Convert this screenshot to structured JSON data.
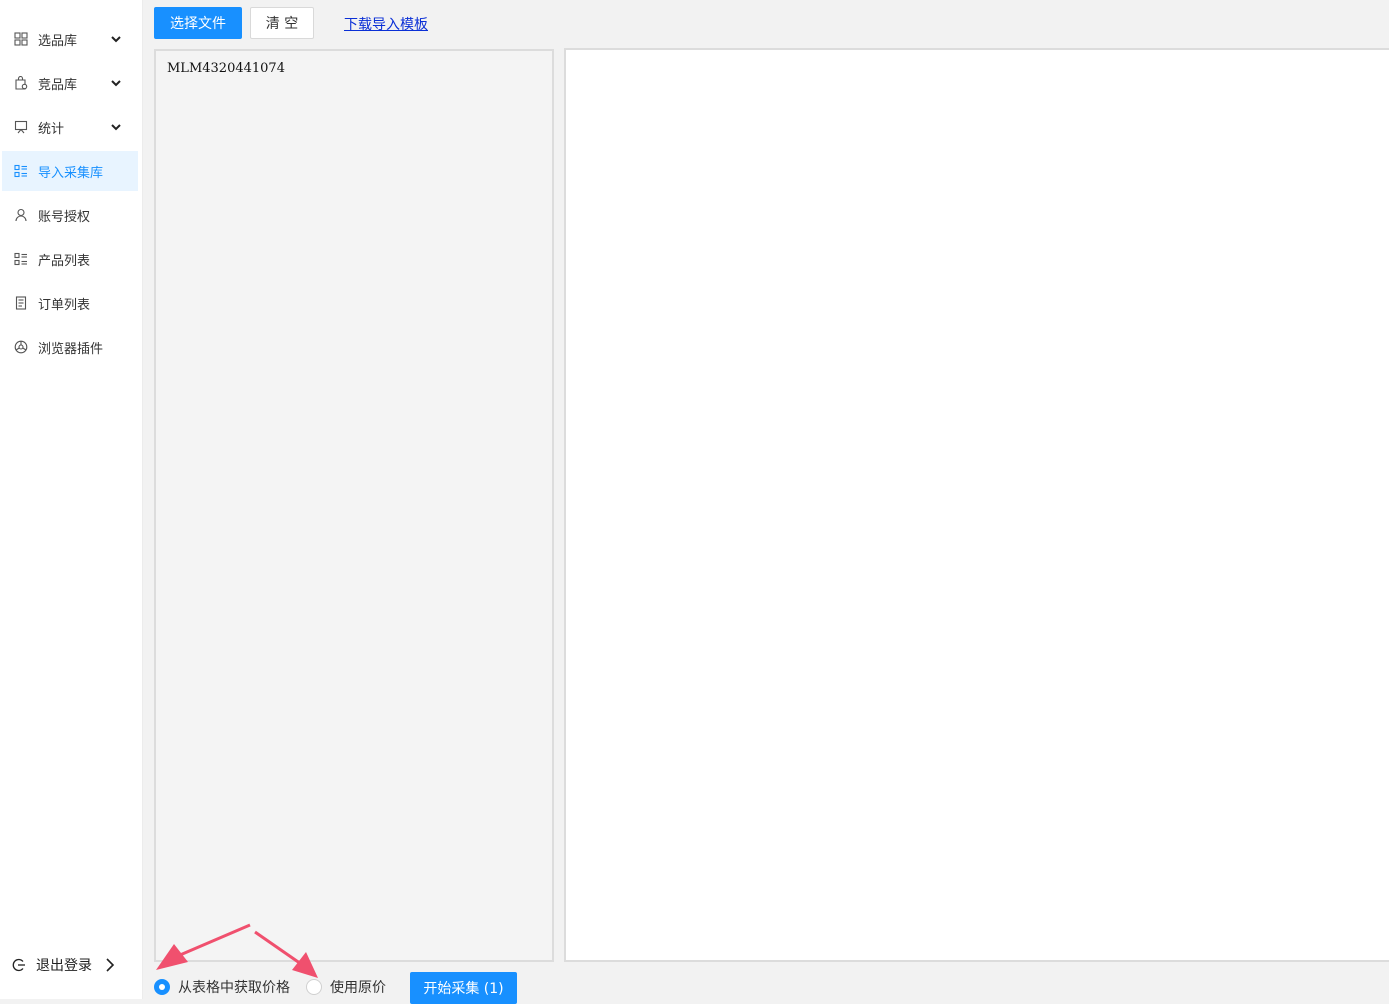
{
  "sidebar": {
    "items": [
      {
        "label": "选品库",
        "icon": "grid-icon",
        "expandable": true
      },
      {
        "label": "竞品库",
        "icon": "bag-icon",
        "expandable": true
      },
      {
        "label": "统计",
        "icon": "board-icon",
        "expandable": true
      },
      {
        "label": "导入采集库",
        "icon": "list-icon",
        "expandable": false,
        "active": true
      },
      {
        "label": "账号授权",
        "icon": "user-icon",
        "expandable": false
      },
      {
        "label": "产品列表",
        "icon": "list-icon",
        "expandable": false
      },
      {
        "label": "订单列表",
        "icon": "document-icon",
        "expandable": false
      },
      {
        "label": "浏览器插件",
        "icon": "plugin-icon",
        "expandable": false
      }
    ],
    "logout_label": "退出登录"
  },
  "toolbar": {
    "select_file_label": "选择文件",
    "clear_label": "清 空",
    "download_template_label": "下载导入模板"
  },
  "input": {
    "value": "MLM4320441074"
  },
  "options": {
    "price_from_table_label": "从表格中获取价格",
    "use_original_price_label": "使用原价",
    "selected": "price_from_table"
  },
  "actions": {
    "start_label": "开始采集 (1)"
  },
  "colors": {
    "primary": "#1890ff",
    "active_bg": "#e8f4ff",
    "annotation": "#f0506e"
  }
}
